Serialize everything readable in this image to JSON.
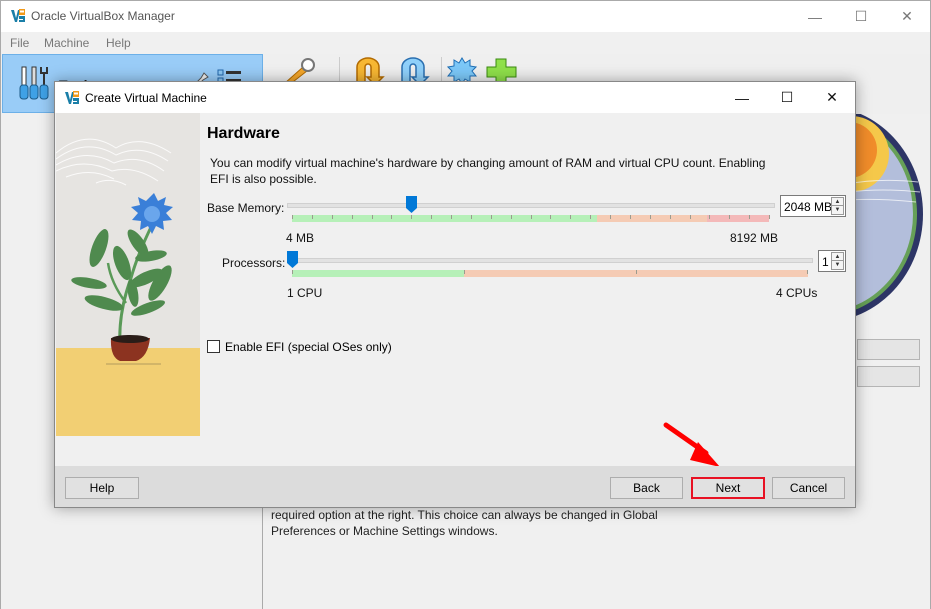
{
  "main_window": {
    "title": "Oracle VirtualBox Manager",
    "controls": {
      "minimize": "—",
      "maximize": "☐",
      "close": "✕"
    },
    "menu": [
      "File",
      "Machine",
      "Help"
    ],
    "tools_label": "Tools",
    "toolbar_icons": [
      "preferences-icon",
      "import-icon",
      "export-icon",
      "new-vm-star-icon",
      "add-icon"
    ],
    "welcome_text_line1": "required option at the right. This choice can always be changed in Global",
    "welcome_text_line2": "Preferences or Machine Settings windows."
  },
  "dialog": {
    "title": "Create Virtual Machine",
    "controls": {
      "minimize": "—",
      "maximize": "☐",
      "close": "✕"
    },
    "heading": "Hardware",
    "description": "You can modify virtual machine's hardware by changing amount of RAM and virtual CPU count. Enabling EFI is also possible.",
    "base_memory": {
      "label": "Base Memory:",
      "value": "2048 MB",
      "value_mb": 2048,
      "min_label": "4 MB",
      "max_label": "8192 MB",
      "min": 4,
      "max": 8192
    },
    "processors": {
      "label": "Processors:",
      "value": "1",
      "value_count": 1,
      "min_label": "1 CPU",
      "max_label": "4 CPUs",
      "min": 1,
      "max": 4
    },
    "efi": {
      "label": "Enable EFI (special OSes only)",
      "checked": false
    },
    "buttons": {
      "help": "Help",
      "back": "Back",
      "next": "Next",
      "cancel": "Cancel"
    }
  },
  "colors": {
    "slider_handle": "#0078d7",
    "safe_zone": "#b6f0b8",
    "warn_zone": "#f5cbb4",
    "danger_zone": "#f4b9b9",
    "highlight": "#e81123"
  }
}
